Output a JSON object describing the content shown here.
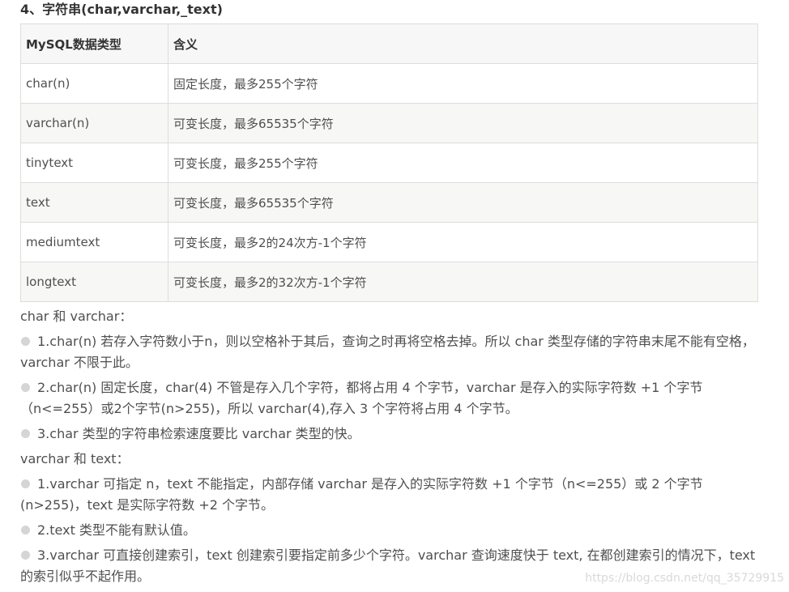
{
  "heading": "4、字符串(char,varchar,_text)",
  "table": {
    "headers": [
      "MySQL数据类型",
      "含义"
    ],
    "rows": [
      [
        "char(n)",
        "固定长度，最多255个字符"
      ],
      [
        "varchar(n)",
        "可变长度，最多65535个字符"
      ],
      [
        "tinytext",
        "可变长度，最多255个字符"
      ],
      [
        "text",
        "可变长度，最多65535个字符"
      ],
      [
        "mediumtext",
        "可变长度，最多2的24次方-1个字符"
      ],
      [
        "longtext",
        "可变长度，最多2的32次方-1个字符"
      ]
    ]
  },
  "section1": {
    "title": "char 和 varchar：",
    "items": [
      "1.char(n) 若存入字符数小于n，则以空格补于其后，查询之时再将空格去掉。所以 char 类型存储的字符串末尾不能有空格，varchar 不限于此。",
      "2.char(n) 固定长度，char(4) 不管是存入几个字符，都将占用 4 个字节，varchar 是存入的实际字符数 +1 个字节（n<=255）或2个字节(n>255)，所以 varchar(4),存入 3 个字符将占用 4 个字节。",
      "3.char 类型的字符串检索速度要比 varchar 类型的快。"
    ]
  },
  "section2": {
    "title": "varchar 和 text：",
    "items": [
      "1.varchar 可指定 n，text 不能指定，内部存储 varchar 是存入的实际字符数 +1 个字节（n<=255）或 2 个字节(n>255)，text 是实际字符数 +2 个字节。",
      "2.text 类型不能有默认值。",
      "3.varchar 可直接创建索引，text 创建索引要指定前多少个字符。varchar 查询速度快于 text, 在都创建索引的情况下，text 的索引似乎不起作用。"
    ]
  },
  "watermark": "https://blog.csdn.net/qq_35729915"
}
